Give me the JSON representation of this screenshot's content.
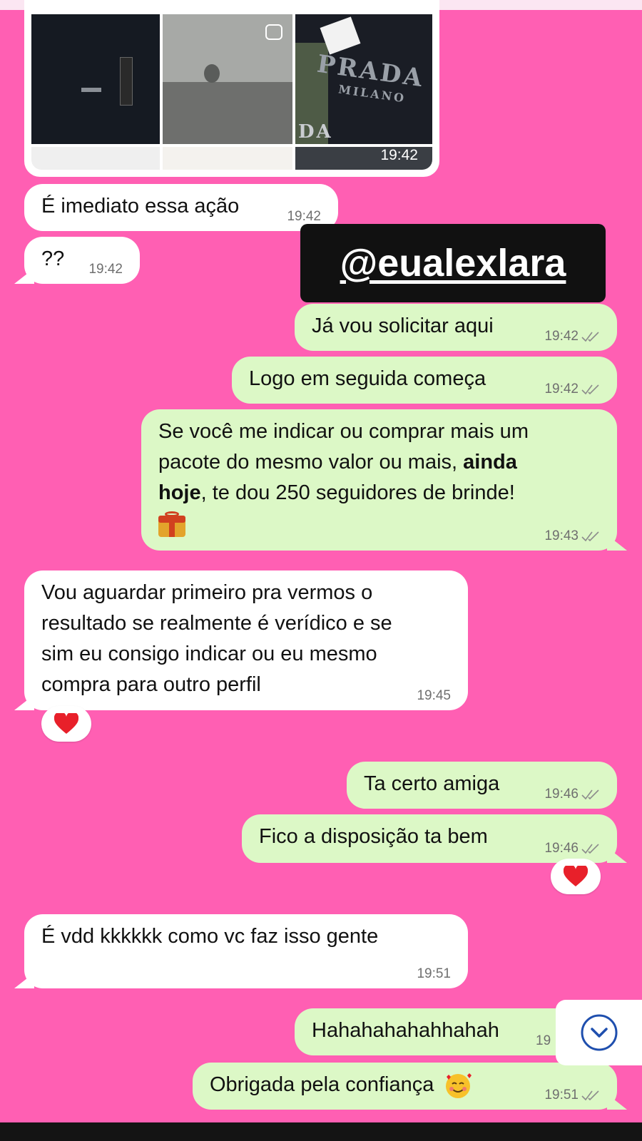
{
  "media": {
    "time": "19:42",
    "brand1": "PRADA",
    "brand2": "MILANO",
    "brand3": "DA"
  },
  "overlay": {
    "tag": "@eualexlara"
  },
  "messages": [
    {
      "text": "É imediato essa ação",
      "time": "19:42",
      "dir": "in"
    },
    {
      "text": "??",
      "time": "19:42",
      "dir": "in"
    },
    {
      "text": "Já vou solicitar aqui",
      "time": "19:42",
      "dir": "out"
    },
    {
      "text": "Logo em seguida começa",
      "time": "19:42",
      "dir": "out"
    },
    {
      "text_a": "Se você me indicar ou comprar mais um\npacote do mesmo valor ou mais, ",
      "text_bold": "ainda\nhoje",
      "text_b": ", te dou 250 seguidores de brinde!",
      "emoji": "gift-emoji",
      "time": "19:43",
      "dir": "out"
    },
    {
      "text": "Vou aguardar primeiro pra vermos o\nresultado se realmente é verídico e se\nsim eu consigo indicar ou eu mesmo\ncompra para outro perfil",
      "time": "19:45",
      "dir": "in",
      "reaction": "heart-emoji"
    },
    {
      "text": "Ta certo amiga",
      "time": "19:46",
      "dir": "out"
    },
    {
      "text": "Fico a disposição ta bem",
      "time": "19:46",
      "dir": "out",
      "reaction": "heart-emoji"
    },
    {
      "text": "É vdd kkkkkk como vc faz isso gente",
      "time": "19:51",
      "dir": "in"
    },
    {
      "text": "Hahahahahahhahah",
      "time": "19",
      "dir": "out"
    },
    {
      "text": "Obrigada pela confiança",
      "emoji": "smiling-hearts-emoji",
      "time": "19:51",
      "dir": "out"
    }
  ],
  "colors": {
    "background": "#ff5fb3",
    "incoming": "#ffffff",
    "outgoing": "#dcf8c6",
    "heart": "#e8202a",
    "scroll_icon": "#1f4fae"
  }
}
